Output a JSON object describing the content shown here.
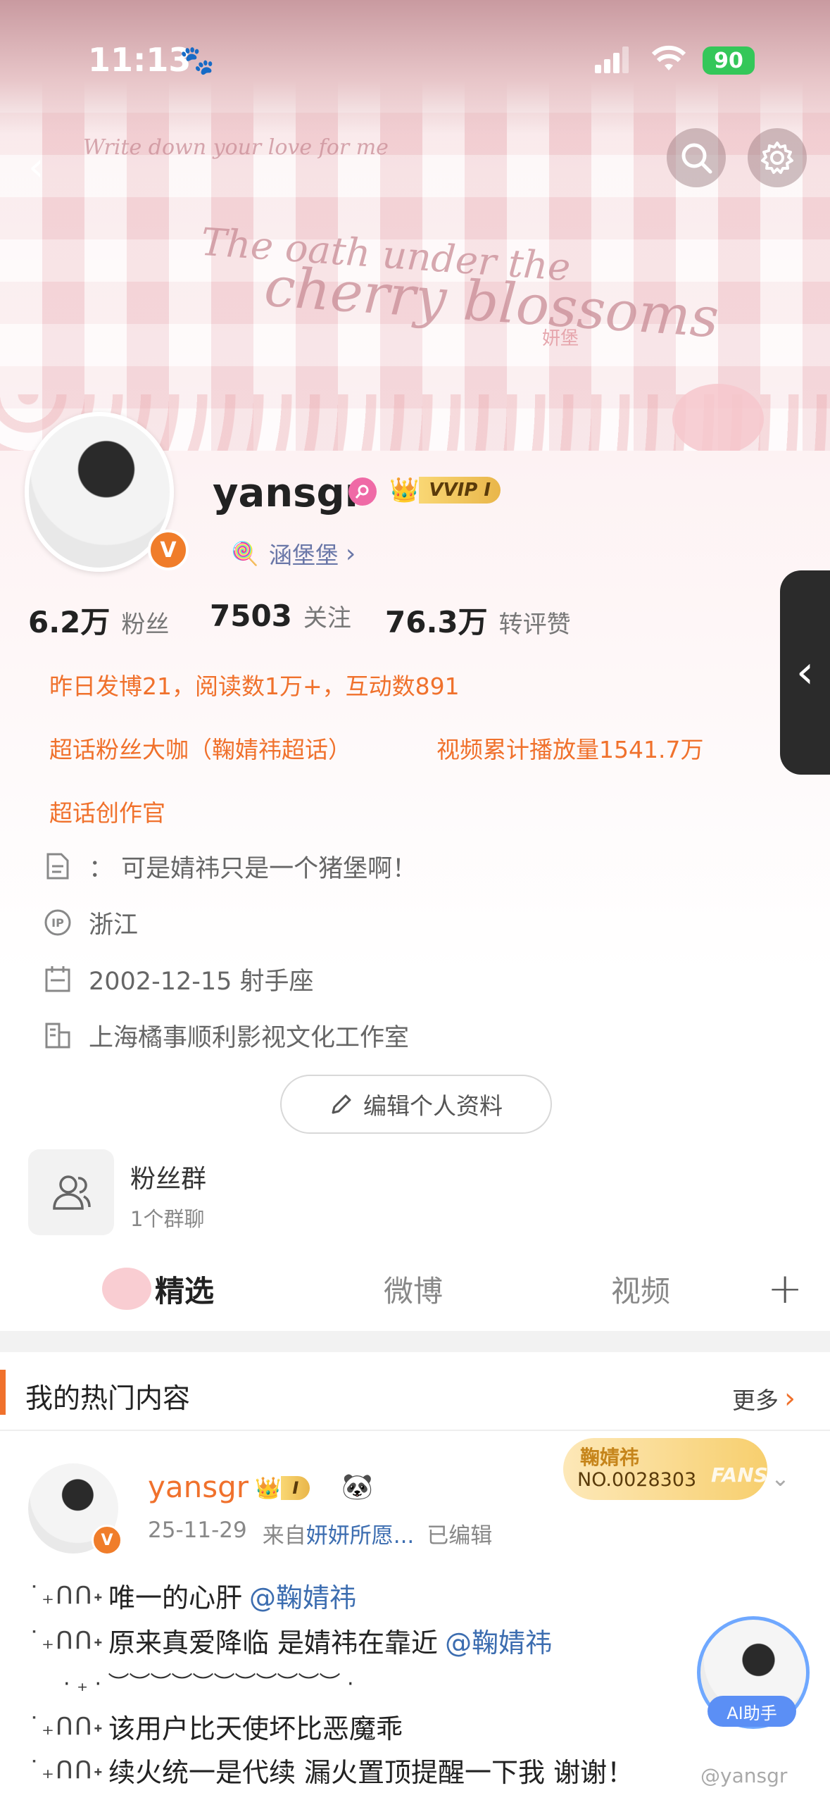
{
  "status_bar": {
    "time": "11:13",
    "battery": "90"
  },
  "banner": {
    "tagline": "Write down your love for me",
    "title_line1": "The oath under the",
    "title_line2": "cherry blossoms",
    "watermark": "妍堡"
  },
  "profile": {
    "username": "yansgr",
    "vip_badge": "VVIP I",
    "verified_mark": "V",
    "alias": "涵堡堡",
    "alias_chevron": "›"
  },
  "stats": [
    {
      "value": "6.2万",
      "label": "粉丝"
    },
    {
      "value": "7503",
      "label": "关注"
    },
    {
      "value": "76.3万",
      "label": "转评赞"
    }
  ],
  "highlights": [
    "昨日发博21，阅读数1万+，互动数891",
    "超话粉丝大咖（鞠婧祎超话）",
    "视频累计播放量1541.7万",
    "超话创作官"
  ],
  "info": {
    "bio": "： 可是婧祎只是一个猪堡啊！",
    "ip": "浙江",
    "birthday": "2002-12-15 射手座",
    "company": "上海橘事顺利影视文化工作室"
  },
  "edit_profile": "编辑个人资料",
  "fan_group": {
    "title": "粉丝群",
    "subtitle": "1个群聊"
  },
  "tabs": [
    "精选",
    "微博",
    "视频"
  ],
  "hot_section": {
    "title": "我的热门内容",
    "more": "更多"
  },
  "post": {
    "author": "yansgr",
    "author_badge": "I",
    "fan_badge_name": "鞠婧祎",
    "fan_badge_no": "NO.0028303",
    "fan_badge_word": "FANS",
    "date": "25-11-29",
    "source_prefix": "来自",
    "source": "妍妍所愿...",
    "edited": "已编辑",
    "lines": [
      {
        "prefix": "˙₊ᑎᑎ˖",
        "text": "唯一的心肝",
        "mention": "@鞠婧祎"
      },
      {
        "prefix": "˙₊ᑎᑎ˖",
        "text": "原来真爱降临 是婧祎在靠近",
        "mention": "@鞠婧祎"
      },
      {
        "prefix": "˙₊ᑎᑎ˖",
        "text": "该用户比天使坏比恶魔乖",
        "mention": ""
      },
      {
        "prefix": "˙₊ᑎᑎ˖",
        "text": "续火统一是代续 漏火置顶提醒一下我 谢谢！",
        "mention": ""
      }
    ],
    "deco_row": "· ₊ · ︶︶︶︶︶︶︶︶︶︶︶ ·"
  },
  "ai_helper": "AI助手",
  "weibo_watermark": "@yansgr",
  "colors": {
    "accent": "#f0712c",
    "mention": "#3c6db0",
    "vip_gold": "#e9b64a"
  }
}
